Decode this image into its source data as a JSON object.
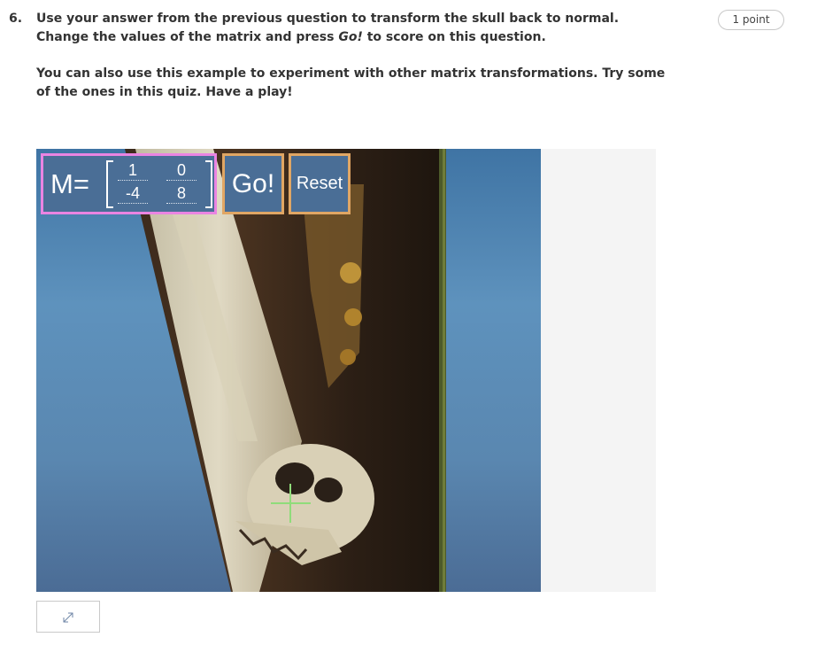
{
  "question": {
    "number": "6.",
    "paragraph1_before": "Use your answer from the previous question to transform the skull back to normal. Change the values of the matrix and press ",
    "paragraph1_emph": "Go!",
    "paragraph1_after": " to score on this question.",
    "paragraph2": "You can also use this example to experiment with other matrix transformations. Try some of the ones in this quiz. Have a play!",
    "points": "1 point"
  },
  "widget": {
    "matrix_label": "M=",
    "matrix": {
      "a": "1",
      "b": "0",
      "c": "-4",
      "d": "8"
    },
    "go_label": "Go!",
    "reset_label": "Reset"
  },
  "icons": {
    "expand": "expand-arrows-icon",
    "crosshair": "crosshair-icon"
  },
  "colors": {
    "matrix_border": "#ea84e2",
    "button_border": "#e0a664",
    "panel_bg": "#4a6e96",
    "crosshair": "#8fdc7a"
  }
}
